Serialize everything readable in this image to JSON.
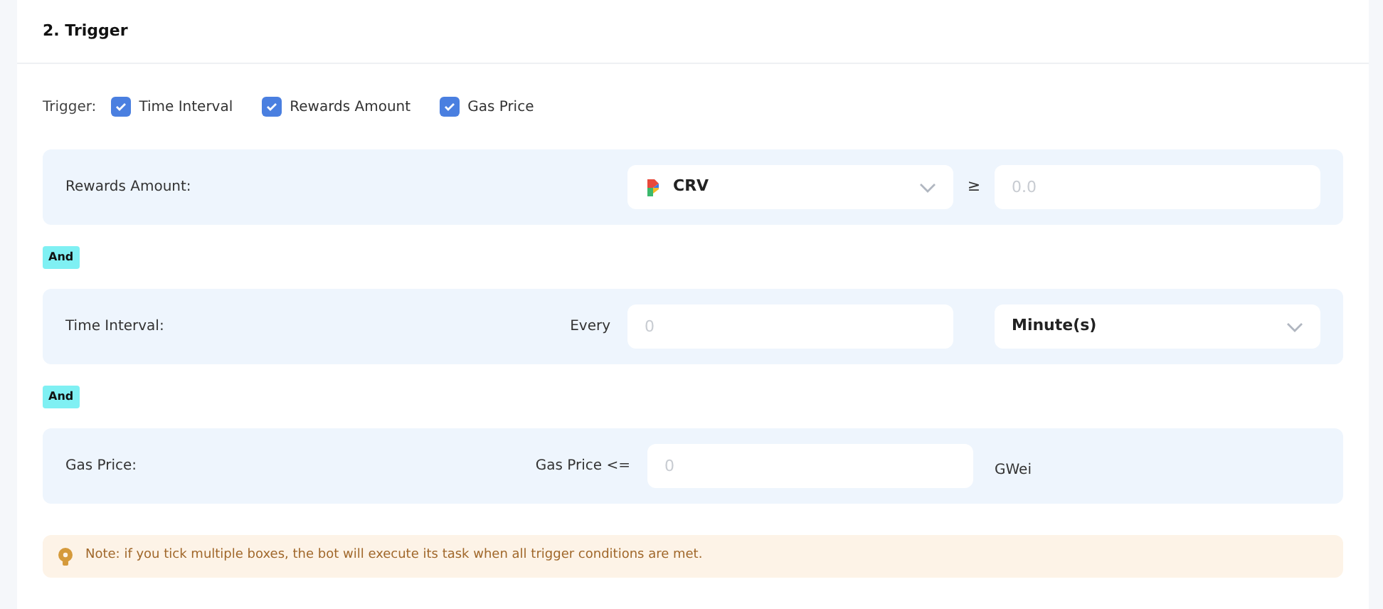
{
  "section_title": "2. Trigger",
  "trigger": {
    "label": "Trigger:",
    "options": [
      {
        "label": "Time Interval",
        "checked": true
      },
      {
        "label": "Rewards Amount",
        "checked": true
      },
      {
        "label": "Gas Price",
        "checked": true
      }
    ]
  },
  "conditions": [
    {
      "label": "Rewards Amount:",
      "field": {
        "kind": "select",
        "value": "CRV",
        "token_icon": true
      },
      "joiner": "≥",
      "field2": {
        "kind": "input",
        "placeholder": "0.0"
      }
    },
    {
      "connector": "And",
      "label": "Time Interval:",
      "prefix": "Every",
      "field": {
        "kind": "input",
        "placeholder": "0"
      },
      "field2": {
        "kind": "select",
        "value": "Minute(s)"
      }
    },
    {
      "connector": "And",
      "label": "Gas Price:",
      "prefix": "Gas Price <=",
      "field": {
        "kind": "input",
        "placeholder": "0"
      },
      "joiner": "GWei"
    }
  ],
  "note": "Note: if you tick multiple boxes, the bot will execute its task when all trigger conditions are met."
}
